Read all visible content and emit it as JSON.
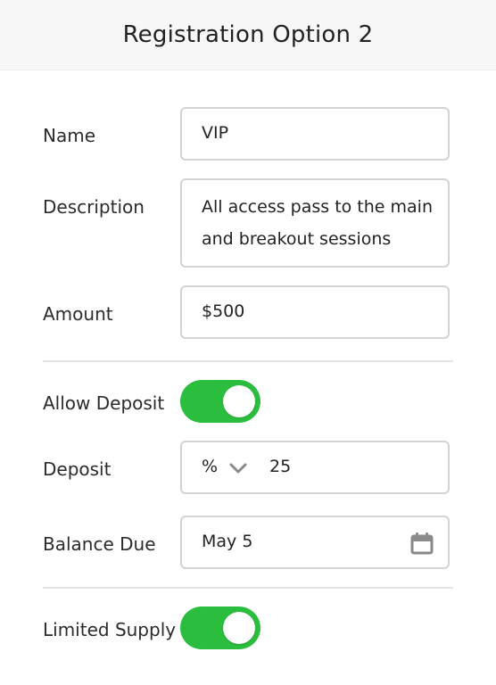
{
  "header": {
    "title": "Registration Option 2"
  },
  "form": {
    "name": {
      "label": "Name",
      "value": "VIP"
    },
    "description": {
      "label": "Description",
      "value": "All access pass to the main and breakout sessions"
    },
    "amount": {
      "label": "Amount",
      "value": "$500"
    },
    "allow_deposit": {
      "label": "Allow Deposit",
      "enabled": true
    },
    "deposit": {
      "label": "Deposit",
      "unit": "%",
      "value": "25"
    },
    "balance_due": {
      "label": "Balance Due",
      "value": "May 5"
    },
    "limited_supply": {
      "label": "Limited Supply",
      "enabled": true
    }
  },
  "icons": {
    "deposit_unit_dropdown": "chevron-down-icon",
    "balance_due_picker": "calendar-icon"
  },
  "colors": {
    "toggle_on": "#2bbd3e",
    "field_border": "#d2d2d2",
    "header_bg": "#f7f7f7",
    "icon_gray": "#8a8a8a"
  }
}
